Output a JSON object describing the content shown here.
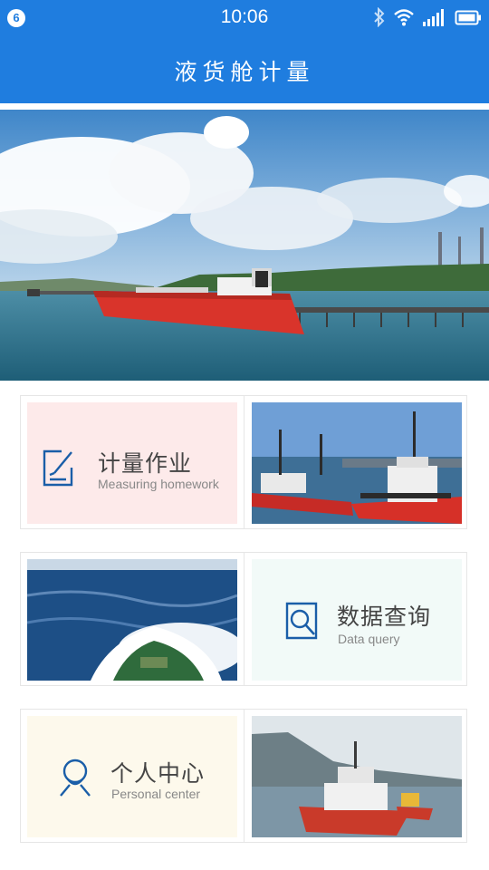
{
  "status_bar": {
    "notification_count": "6",
    "time": "10:06",
    "icons": [
      "bluetooth-icon",
      "wifi-icon",
      "signal-icon",
      "battery-icon"
    ]
  },
  "header": {
    "title": "液货舱计量"
  },
  "banner": {
    "slide_count": 3,
    "active_slide": 3
  },
  "menu": {
    "measuring": {
      "title": "计量作业",
      "subtitle": "Measuring homework",
      "icon": "edit-icon",
      "bg": "#fdeaea"
    },
    "query": {
      "title": "数据查询",
      "subtitle": "Data query",
      "icon": "search-icon",
      "bg": "#f2faf8"
    },
    "personal": {
      "title": "个人中心",
      "subtitle": "Personal center",
      "icon": "person-icon",
      "bg": "#fdf9ec"
    }
  },
  "colors": {
    "primary": "#1f7ddf",
    "icon_blue": "#1a5ea8"
  }
}
